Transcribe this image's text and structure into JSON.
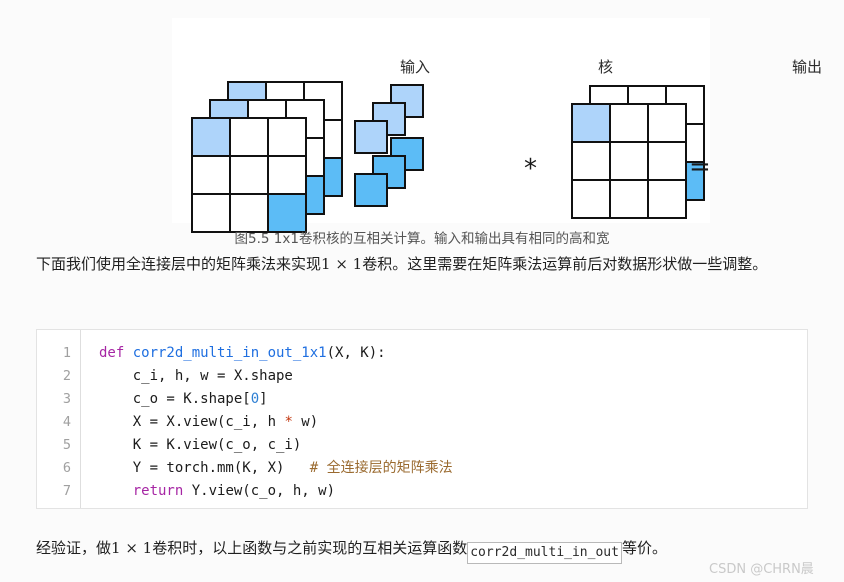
{
  "figure": {
    "labels": {
      "input": "输入",
      "kernel": "核",
      "output": "输出"
    },
    "operators": {
      "convolve": "*",
      "equals": "="
    },
    "caption": "图5.5 1x1卷积核的互相关计算。输入和输出具有相同的高和宽",
    "colors": {
      "highlight_light": "#aed4fa",
      "highlight_mid": "#5cbcf6",
      "cell_border": "#111111",
      "cell_fill": "#ffffff"
    },
    "structure": {
      "input_layers": 3,
      "input_grid": "3x3",
      "kernel_squares_light": 3,
      "kernel_squares_mid": 3,
      "output_layers": 2,
      "output_grid": "3x3"
    }
  },
  "paragraphs": {
    "intro_a": "下面我们使用全连接层中的矩阵乘法来实现",
    "intro_math": "1 × 1",
    "intro_b": "卷积。这里需要在矩阵乘法运算前后对数据形状做一些调整。",
    "closing_a": "经验证，做",
    "closing_math": "1 × 1",
    "closing_b": "卷积时，以上函数与之前实现的互相关运算函数",
    "closing_code": "corr2d_multi_in_out",
    "closing_c": "等价。"
  },
  "code": {
    "line_numbers": [
      "1",
      "2",
      "3",
      "4",
      "5",
      "6",
      "7"
    ],
    "lines": [
      {
        "n": "1",
        "parts": [
          {
            "t": "def ",
            "c": "tok-kw"
          },
          {
            "t": "corr2d_multi_in_out_1x1",
            "c": "tok-fn"
          },
          {
            "t": "(X, K):",
            "c": ""
          }
        ]
      },
      {
        "n": "2",
        "parts": [
          {
            "t": "    c_i, h, w = X.shape",
            "c": ""
          }
        ]
      },
      {
        "n": "3",
        "parts": [
          {
            "t": "    c_o = K.shape[",
            "c": ""
          },
          {
            "t": "0",
            "c": "tok-num"
          },
          {
            "t": "]",
            "c": ""
          }
        ]
      },
      {
        "n": "4",
        "parts": [
          {
            "t": "    X = X.view(c_i, h ",
            "c": ""
          },
          {
            "t": "*",
            "c": "tok-op"
          },
          {
            "t": " w)",
            "c": ""
          }
        ]
      },
      {
        "n": "5",
        "parts": [
          {
            "t": "    K = K.view(c_o, c_i)",
            "c": ""
          }
        ]
      },
      {
        "n": "6",
        "parts": [
          {
            "t": "    Y = torch.mm(K, X)   ",
            "c": ""
          },
          {
            "t": "# 全连接层的矩阵乘法",
            "c": "tok-comment"
          }
        ]
      },
      {
        "n": "7",
        "parts": [
          {
            "t": "    ",
            "c": ""
          },
          {
            "t": "return",
            "c": "tok-kw"
          },
          {
            "t": " Y.view(c_o, h, w)",
            "c": ""
          }
        ]
      }
    ]
  },
  "watermark": "CSDN @CHRN晨"
}
